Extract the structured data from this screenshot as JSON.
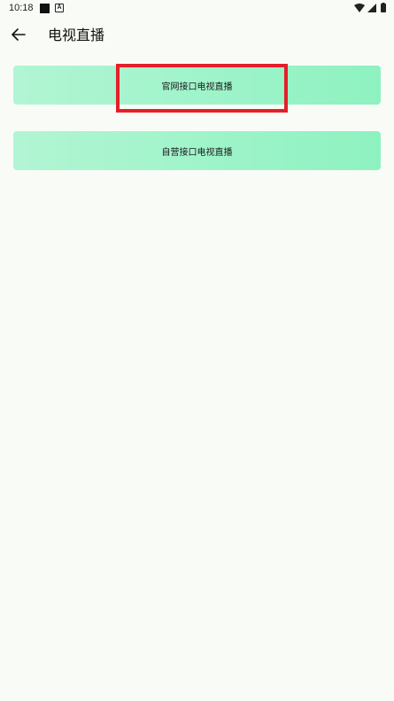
{
  "status_bar": {
    "time": "10:18",
    "icons": [
      "notification-square-icon",
      "notification-a-icon",
      "wifi-icon",
      "signal-icon",
      "battery-icon"
    ]
  },
  "app_bar": {
    "back_icon": "arrow-left-icon",
    "title": "电视直播"
  },
  "buttons": {
    "official": "官网接口电视直播",
    "self": "自营接口电视直播"
  },
  "colors": {
    "background": "#f9fcf6",
    "button_gradient_start": "#b2f5d4",
    "button_gradient_end": "#8ef2c0",
    "highlight": "#e3202a"
  }
}
